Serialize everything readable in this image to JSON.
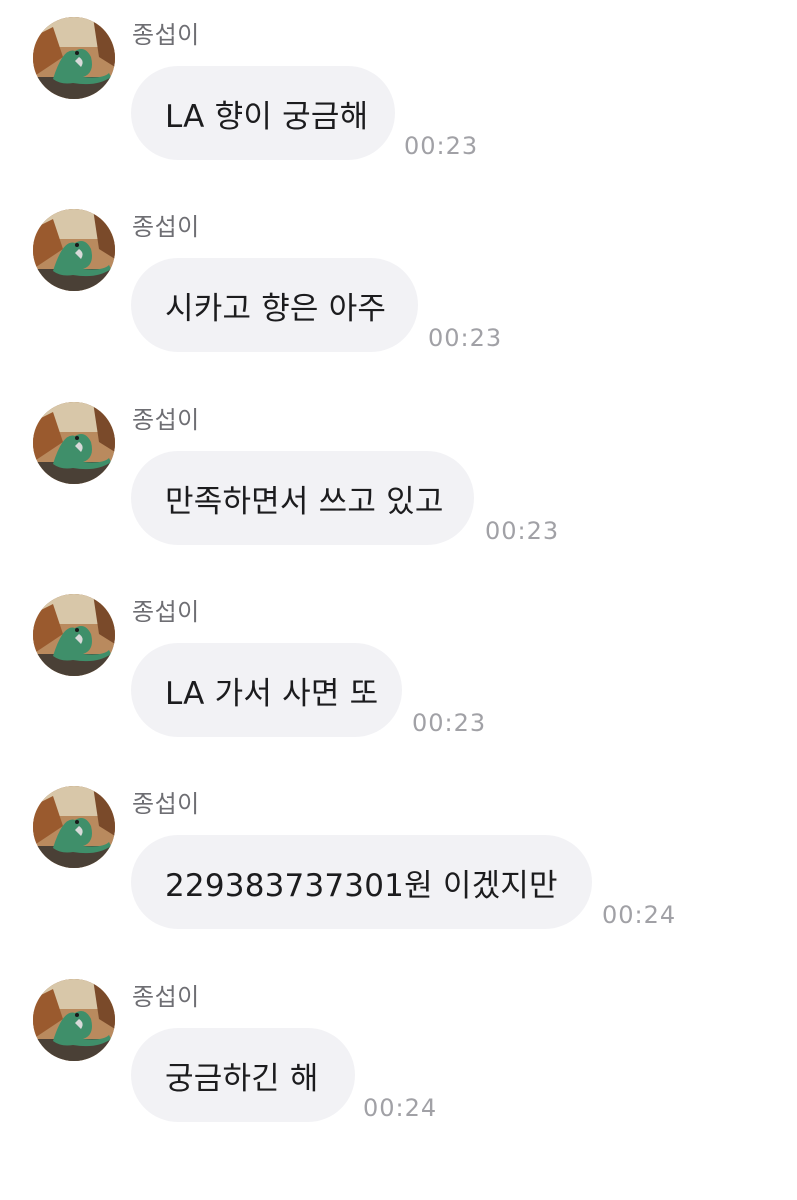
{
  "messages": [
    {
      "sender": "종섭이",
      "text": "LA 향이 궁금해",
      "time": "00:23",
      "avatar_icon": "lizard-avatar-icon"
    },
    {
      "sender": "종섭이",
      "text": "시카고 향은 아주",
      "time": "00:23",
      "avatar_icon": "lizard-avatar-icon"
    },
    {
      "sender": "종섭이",
      "text": "만족하면서 쓰고 있고",
      "time": "00:23",
      "avatar_icon": "lizard-avatar-icon"
    },
    {
      "sender": "종섭이",
      "text": "LA 가서 사면 또",
      "time": "00:23",
      "avatar_icon": "lizard-avatar-icon"
    },
    {
      "sender": "종섭이",
      "text": "229383737301원 이겠지만",
      "time": "00:24",
      "avatar_icon": "lizard-avatar-icon"
    },
    {
      "sender": "종섭이",
      "text": "궁금하긴 해",
      "time": "00:24",
      "avatar_icon": "lizard-avatar-icon"
    }
  ],
  "colors": {
    "bubble_bg": "#f2f2f5",
    "text": "#1c1c1e",
    "sender": "#6e6e73",
    "time": "#a1a1a6"
  }
}
